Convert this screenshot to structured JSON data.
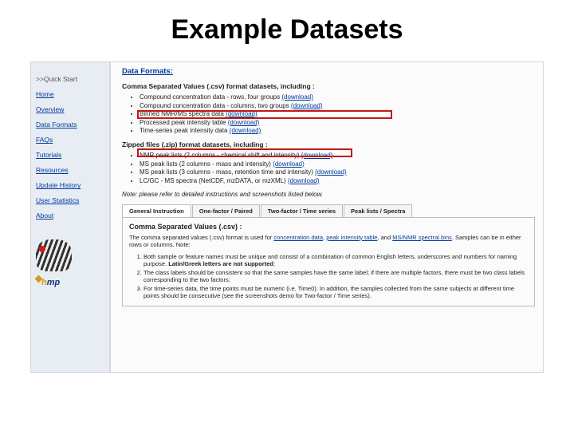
{
  "title": "Example Datasets",
  "sidebar": {
    "quickstart": ">>Quick Start",
    "items": [
      "Home",
      "Overview",
      "Data Formats",
      "FAQs",
      "Tutorials",
      "Resources",
      "Update History",
      "User Statistics",
      "About"
    ],
    "logo_text": "hmp"
  },
  "content": {
    "heading": "Data Formats:",
    "csv_intro": "Comma Separated Values (.csv) format datasets, including :",
    "csv_items": [
      {
        "text": "Compound concentration data - rows, four groups",
        "dl": "(download)"
      },
      {
        "text": "Compound concentration data - columns, two groups",
        "dl": "(download)"
      },
      {
        "text": "Binned NMR/MS spectra data",
        "dl": "(download)"
      },
      {
        "text": "Processed peak intensity table",
        "dl": "(download)"
      },
      {
        "text": "Time-series peak intensity data",
        "dl": "(download)"
      }
    ],
    "zip_intro": "Zipped files (.zip) format datasets, including :",
    "zip_items": [
      {
        "text": "NMR peak lists (2 columns - chemical shift and intensity)",
        "dl": "(download)"
      },
      {
        "text": "MS peak lists (2 columns - mass and intensity)",
        "dl": "(download)"
      },
      {
        "text": "MS peak lists (3 columns - mass, retention time and intensity)",
        "dl": "(download)"
      },
      {
        "text": "LC/GC - MS spectra (NetCDF, mzDATA, or mzXML)",
        "dl": "(download)"
      }
    ],
    "note": "Note: please refer to detailed instructions and screenshots listed below.",
    "tabs": {
      "items": [
        "General Instruction",
        "One-factor / Paired",
        "Two-factor / Time series",
        "Peak lists / Spectra"
      ],
      "active_title": "Comma Separated Values (.csv) :",
      "para1_a": "The comma separated values (.csv) format is used for ",
      "para1_links": [
        "concentration data",
        "peak intensity table",
        "MS/NMR spectral bins"
      ],
      "para1_join": ", ",
      "para1_and": ", and ",
      "para1_b": ". Samples can be in either rows or columns. Note:",
      "ol": [
        {
          "pre": "Both sample or feature names must be unique and consist of a combination of common English letters, underscores and numbers for naming purpose. ",
          "bold": "Latin/Greek letters are not supported",
          "post": ";"
        },
        {
          "pre": "The class labels should be consistent so that the same samples have the same label; if there are multiple factors, there must be two class labels corresponding to the two factors;",
          "bold": "",
          "post": ""
        },
        {
          "pre": "For time-series data, the time points must be numeric (i.e. Time0). In addition, the samples collected from the same subjects at different time points should be consecutive (see the screenshots demo for Two-factor / Time series).",
          "bold": "",
          "post": ""
        }
      ]
    }
  }
}
